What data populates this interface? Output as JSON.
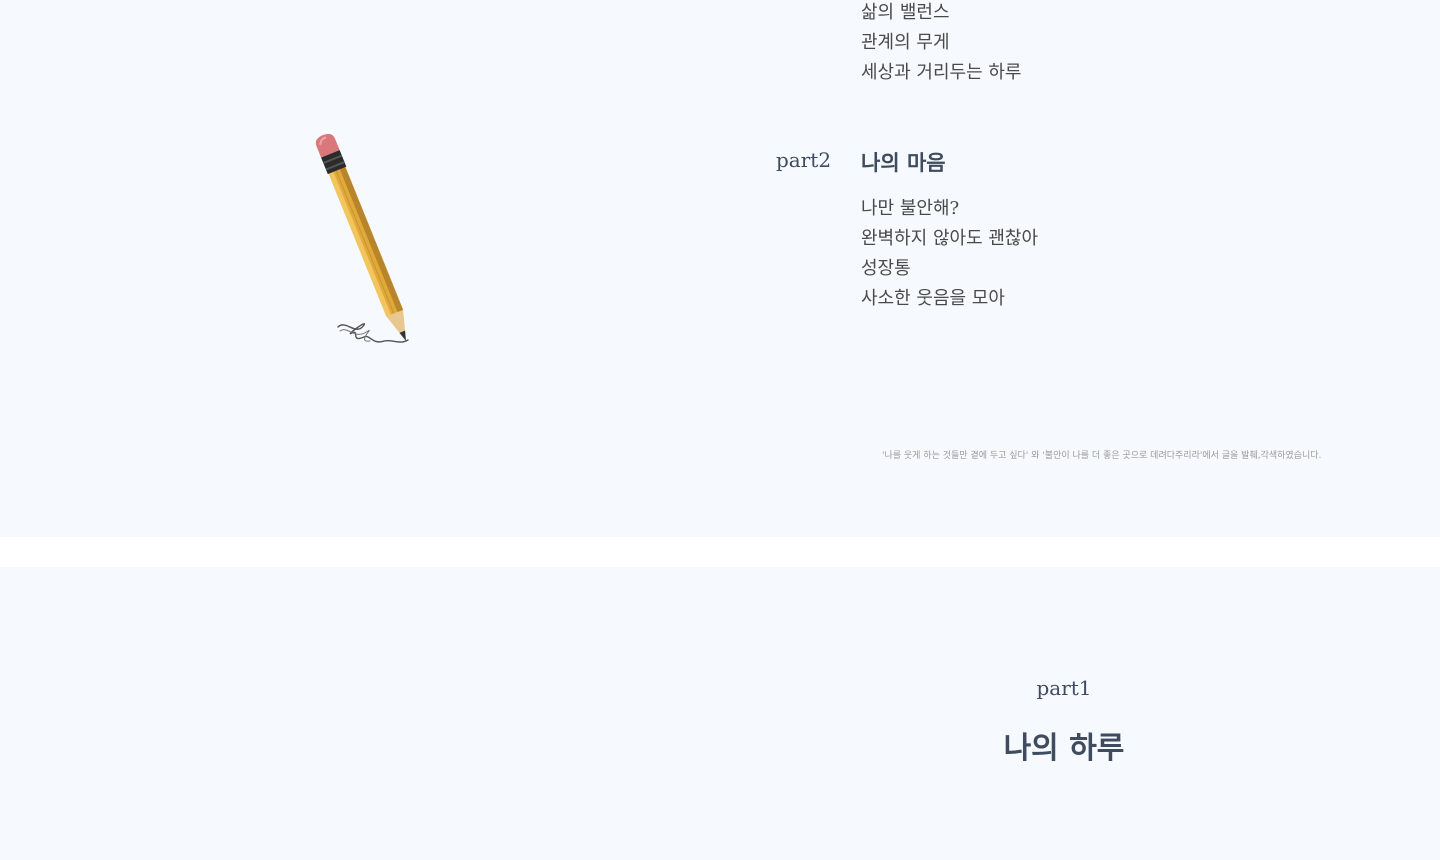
{
  "top_section": {
    "part1_items": [
      "삶의 밸런스",
      "관계의 무게",
      "세상과 거리두는 하루"
    ],
    "part2": {
      "label": "part2",
      "title": "나의 마음",
      "items": [
        "나만 불안해?",
        "완벽하지 않아도 괜찮아",
        "성장통",
        "사소한 웃음을 모아"
      ]
    },
    "footnote": "'나를 웃게 하는 것들만 곁에 두고 싶다' 와 '불안이 나를 더 좋은 곳으로 데려다주리라'에서 글을 발췌,각색하였습니다."
  },
  "bottom_section": {
    "label": "part1",
    "title": "나의 하루"
  },
  "illustration": {
    "icon": "pencil-icon",
    "colors": {
      "pencil_body": "#e0a93a",
      "eraser": "#d9777a",
      "ferrule": "#2b2b2b"
    }
  }
}
